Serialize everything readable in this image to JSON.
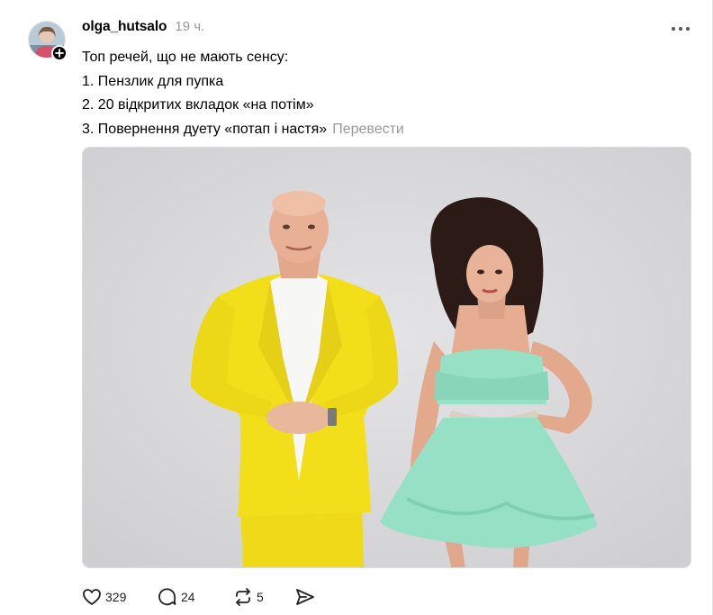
{
  "post": {
    "username": "olga_hutsalo",
    "timestamp": "19 ч.",
    "lines": [
      "Топ речей, що не мають сенсу:",
      "1. Пензлик для пупка",
      "2. 20 відкритих вкладок «на потім»",
      "3. Повернення дуету «потап і настя»"
    ],
    "translate_label": "Перевести"
  },
  "actions": {
    "likes": "329",
    "replies": "24",
    "reposts": "5"
  },
  "icons": {
    "avatar": "avatar",
    "follow": "plus-icon",
    "more": "more-horizontal-icon",
    "like": "heart-icon",
    "reply": "comment-icon",
    "repost": "repost-icon",
    "share": "send-icon"
  },
  "colors": {
    "text": "#000000",
    "muted": "#999999",
    "photo_background": "#d9d9db",
    "suit": "#f2df1a",
    "dress": "#96e0c6"
  }
}
